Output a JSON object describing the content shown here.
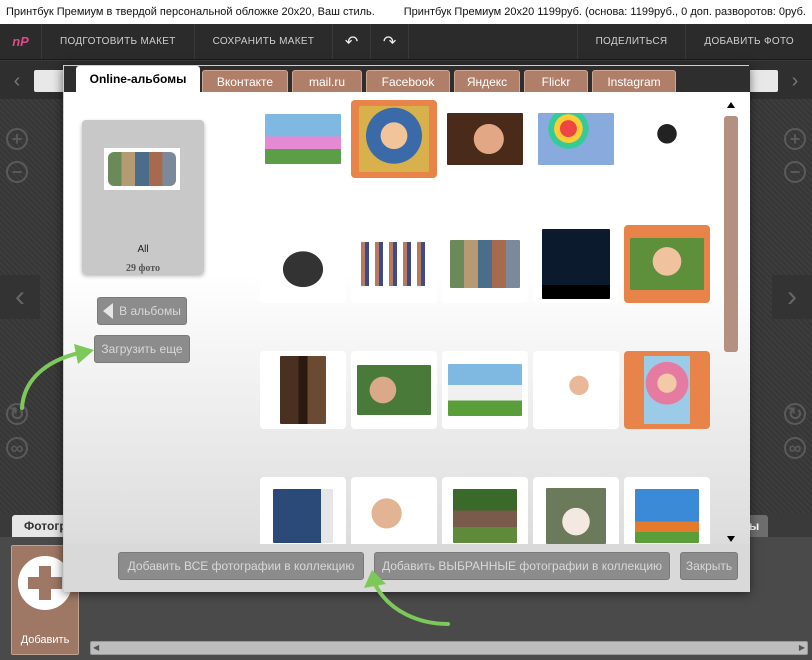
{
  "info_bar": {
    "left_text": "Принтбук Премиум в твердой персональной обложке 20x20, Ваш стиль.",
    "right_text": "Принтбук Премиум 20x20  1199руб. (основа: 1199руб., 0 доп. разворотов: 0руб."
  },
  "toolbar": {
    "logo": "nP",
    "prepare_layout": "ПОДГОТОВИТЬ МАКЕТ",
    "save_layout": "СОХРАНИТЬ МАКЕТ",
    "undo_icon": "↶",
    "redo_icon": "↷",
    "share": "ПОДЕЛИТЬСЯ",
    "add_photo": "ДОБАВИТЬ ФОТО"
  },
  "modal": {
    "tabs": [
      {
        "label": "Online-альбомы",
        "active": true
      },
      {
        "label": "Вконтакте",
        "active": false
      },
      {
        "label": "mail.ru",
        "active": false
      },
      {
        "label": "Facebook",
        "active": false
      },
      {
        "label": "Яндекс",
        "active": false
      },
      {
        "label": "Flickr",
        "active": false
      },
      {
        "label": "Instagram",
        "active": false
      }
    ],
    "album": {
      "name": "All",
      "count": "29 фото"
    },
    "back_button": "В альбомы",
    "load_more_button": "Загрузить еще",
    "photos": [
      {
        "icon": "flowers-photo",
        "selected": false
      },
      {
        "icon": "boy-photo",
        "selected": true
      },
      {
        "icon": "woman-shh-photo",
        "selected": false
      },
      {
        "icon": "balloons-photo",
        "selected": false
      },
      {
        "icon": "businessman-photo",
        "selected": false
      },
      {
        "icon": "group-photo",
        "selected": false
      },
      {
        "icon": "people-line-photo",
        "selected": false
      },
      {
        "icon": "collage-photo",
        "selected": false
      },
      {
        "icon": "night-sky-photo",
        "selected": false
      },
      {
        "icon": "man-smiling-photo",
        "selected": true
      },
      {
        "icon": "wall-man-photo",
        "selected": false
      },
      {
        "icon": "seniors-photo",
        "selected": false
      },
      {
        "icon": "family-photo",
        "selected": false
      },
      {
        "icon": "woman-card-photo",
        "selected": false
      },
      {
        "icon": "bunny-girl-photo",
        "selected": true
      },
      {
        "icon": "photobook-photo",
        "selected": false
      },
      {
        "icon": "grandparents-photo",
        "selected": false
      },
      {
        "icon": "couple-photo",
        "selected": false
      },
      {
        "icon": "wedding-photo",
        "selected": false
      },
      {
        "icon": "kids-jump-photo",
        "selected": false
      }
    ],
    "footer": {
      "add_all": "Добавить ВСЕ фотографии в коллекцию",
      "add_selected": "Добавить ВЫБРАННЫЕ фотографии в коллекцию",
      "close": "Закрыть"
    }
  },
  "bottom": {
    "tab_left": "Фотографии",
    "tab_right": "ы",
    "add_label": "Добавить"
  },
  "colors": {
    "accent_brown": "#b07f69",
    "selected_orange": "#e8834a",
    "logo_pink": "#e0478c",
    "arrow_green": "#7cc95a"
  }
}
